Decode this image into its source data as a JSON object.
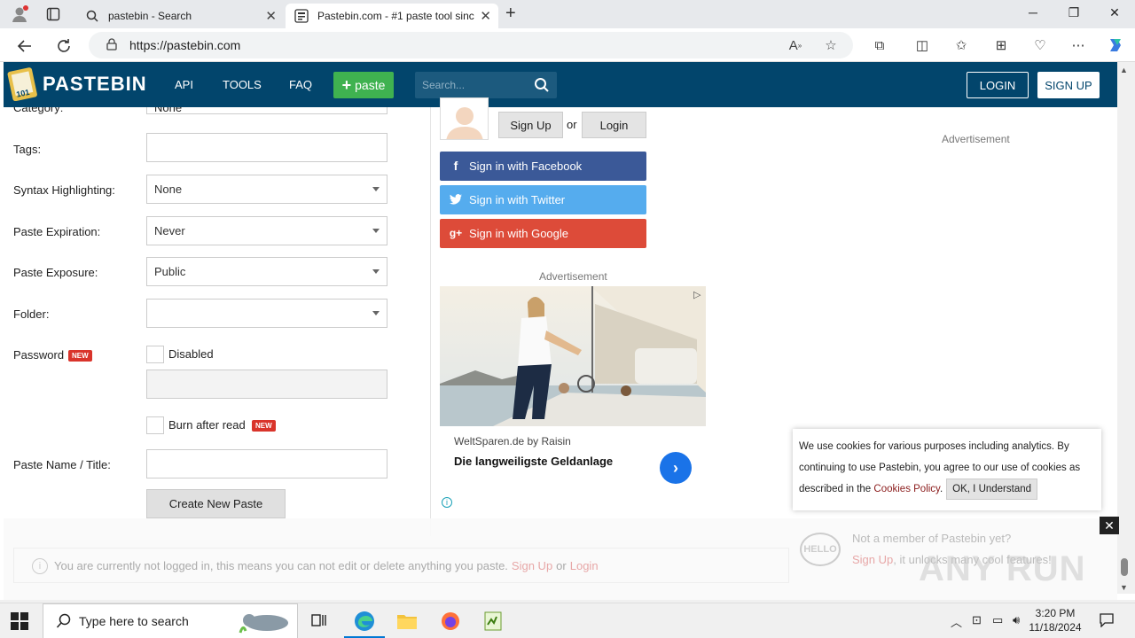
{
  "browser": {
    "tabs": [
      {
        "label": "pastebin - Search",
        "icon": "search-icon"
      },
      {
        "label": "Pastebin.com - #1 paste tool sinc",
        "icon": "pastebin-favicon"
      }
    ],
    "url": "https://pastebin.com"
  },
  "header": {
    "logo_text": "PASTEBIN",
    "menu": [
      "API",
      "TOOLS",
      "FAQ"
    ],
    "paste_button": "paste",
    "search_placeholder": "Search...",
    "login": "LOGIN",
    "signup": "SIGN UP"
  },
  "form": {
    "category_label": "Category:",
    "category_value": "None",
    "tags_label": "Tags:",
    "syntax_label": "Syntax Highlighting:",
    "syntax_value": "None",
    "expiration_label": "Paste Expiration:",
    "expiration_value": "Never",
    "exposure_label": "Paste Exposure:",
    "exposure_value": "Public",
    "folder_label": "Folder:",
    "password_label": "Password",
    "new_badge": "NEW",
    "password_checkbox_label": "Disabled",
    "burn_label": "Burn after read",
    "name_label": "Paste Name / Title:",
    "create_button": "Create New Paste"
  },
  "sidebar": {
    "signup_btn": "Sign Up",
    "or": "or",
    "login_btn": "Login",
    "facebook": "Sign in with Facebook",
    "twitter": "Sign in with Twitter",
    "google": "Sign in with Google",
    "advertisement": "Advertisement"
  },
  "ad": {
    "sponsor": "WeltSparen.de by Raisin",
    "headline": "Die langweiligste Geldanlage"
  },
  "cookie": {
    "text1": "We use cookies for various purposes including analytics. By continuing to use Pastebin, you agree to our use of cookies as described in the ",
    "link": "Cookies Policy",
    "ok": "OK, I Understand"
  },
  "notice": {
    "text": "You are currently not logged in, this means you can not edit or delete anything you paste.",
    "signup": "Sign Up",
    "or": "or",
    "login": "Login"
  },
  "promo": {
    "line1": "Not a member of Pastebin yet?",
    "signup": "Sign Up",
    "line2": ", it unlocks many cool features!",
    "hello": "HELLO"
  },
  "watermark": "ANY RUN",
  "taskbar": {
    "search_placeholder": "Type here to search",
    "time": "3:20 PM",
    "date": "11/18/2024"
  }
}
